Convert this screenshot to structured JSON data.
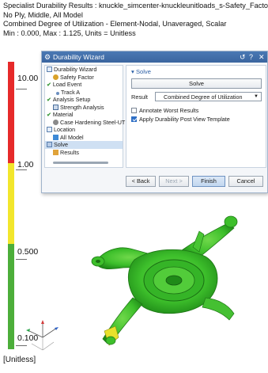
{
  "header": {
    "line1": "Specialist Durability Results : knuckle_simcenter-knuckleunitloads_s-Safety_Factor",
    "line2": "No Ply, Middle, All Model",
    "line3": "Combined Degree of Utilization - Element-Nodal, Unaveraged, Scalar",
    "line4": "Min : 0.000, Max : 1.125, Units = Unitless"
  },
  "legend": {
    "labels": [
      "10.00",
      "1.00",
      "0.500",
      "0.100"
    ],
    "units": "[Unitless]",
    "colors": {
      "red": "#e62a2a",
      "yellow": "#f2e62c",
      "green": "#4cae3a"
    }
  },
  "dialog": {
    "title": "Durability Wizard",
    "controls": {
      "reset": "↺",
      "help": "?",
      "close": "✕"
    },
    "tree": [
      {
        "label": "Durability Wizard",
        "icon": "wizard-icon",
        "indent": 0
      },
      {
        "label": "Safety Factor",
        "icon": "factor-icon",
        "indent": 1
      },
      {
        "label": "Load Event",
        "icon": "check-icon",
        "indent": 0
      },
      {
        "label": "Track A",
        "icon": "track-icon",
        "indent": 1
      },
      {
        "label": "Analysis Setup",
        "icon": "check-icon",
        "indent": 0
      },
      {
        "label": "Strength Analysis",
        "icon": "analysis-icon",
        "indent": 1
      },
      {
        "label": "Material",
        "icon": "check-icon",
        "indent": 0
      },
      {
        "label": "Case Hardening Steel-UT",
        "icon": "material-icon",
        "indent": 1
      },
      {
        "label": "Location",
        "icon": "location-icon",
        "indent": 0
      },
      {
        "label": "All Model",
        "icon": "model-icon",
        "indent": 1
      },
      {
        "label": "Solve",
        "icon": "solve-icon",
        "indent": 0,
        "selected": true
      },
      {
        "label": "Results",
        "icon": "results-icon",
        "indent": 1
      }
    ],
    "panel": {
      "section": "Solve",
      "solve_button": "Solve",
      "result_label": "Result",
      "result_value": "Combined Degree of Utilization",
      "annotate_label": "Annotate Worst Results",
      "annotate_checked": false,
      "apply_label": "Apply Durability Post View Template",
      "apply_checked": true
    },
    "buttons": {
      "back": "< Back",
      "next": "Next >",
      "finish": "Finish",
      "cancel": "Cancel"
    }
  }
}
